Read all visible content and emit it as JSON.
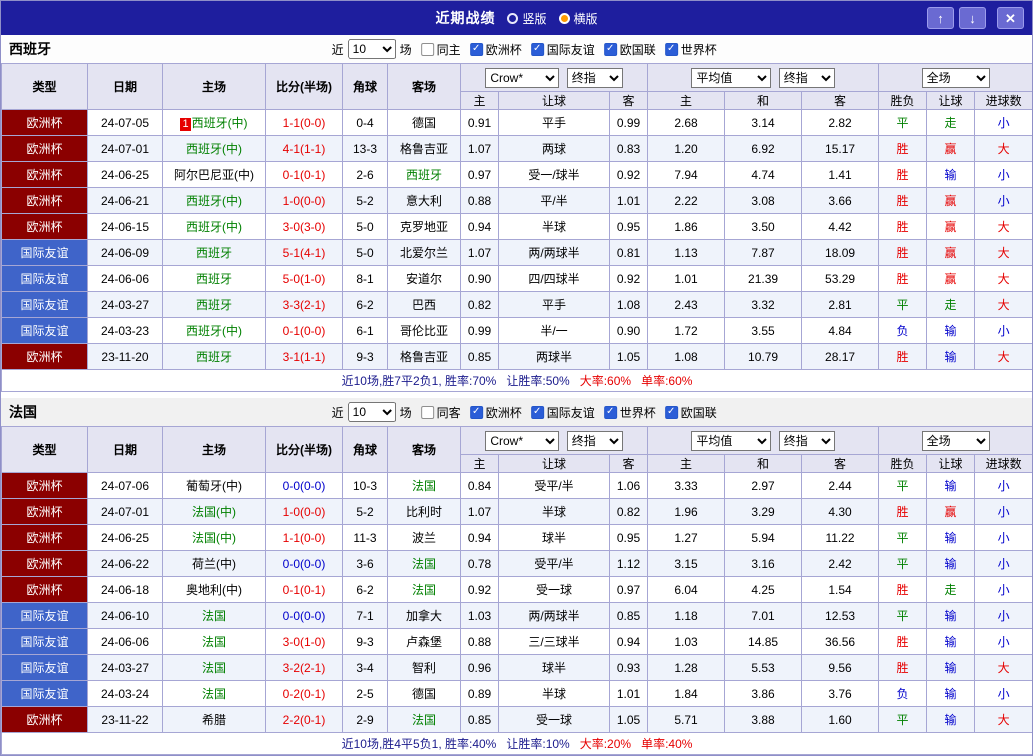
{
  "icons": {
    "check": "✓",
    "up": "↑",
    "down": "↓",
    "close": "✕"
  },
  "palette": {
    "navy": "#1e1e9e",
    "euro": "#8b0000",
    "friendly": "#3f64c9",
    "green": "#008000",
    "red": "#e60000",
    "blue": "#0000cc",
    "orange": "#ff9c00",
    "summary_navy": "#1a1a8c"
  },
  "titlebar": {
    "title": "近期战绩",
    "radios": [
      {
        "label": "竖版",
        "selected": false
      },
      {
        "label": "横版",
        "selected": true
      }
    ]
  },
  "table_header": {
    "type": "类型",
    "date": "日期",
    "home": "主场",
    "score": "比分(半场)",
    "corner": "角球",
    "away": "客场",
    "ah_select_1": "Crow*",
    "ah_select_2": "终指",
    "eu_select_1": "平均值",
    "eu_select_2": "终指",
    "res_select": "全场",
    "sub_ah_home": "主",
    "sub_ah_line": "让球",
    "sub_ah_away": "客",
    "sub_eu_home": "主",
    "sub_eu_draw": "和",
    "sub_eu_away": "客",
    "sub_result": "胜负",
    "sub_ah_result": "让球",
    "sub_ou_result": "进球数"
  },
  "result_colors": {
    "胜": "red",
    "平": "green",
    "负": "blue",
    "赢": "red",
    "走": "green",
    "输": "blue",
    "大": "red",
    "小": "blue"
  },
  "sections": [
    {
      "team": "西班牙",
      "filter": {
        "near": "近",
        "count": "10",
        "games": "场",
        "same": "同主",
        "same_checked": false,
        "comps": [
          {
            "label": "欧洲杯",
            "checked": true
          },
          {
            "label": "国际友谊",
            "checked": true
          },
          {
            "label": "欧国联",
            "checked": true
          },
          {
            "label": "世界杯",
            "checked": true
          }
        ]
      },
      "rows": [
        {
          "type": "欧洲杯",
          "tkey": "euro",
          "date": "24-07-05",
          "home": "西班牙(中)",
          "badge": "1",
          "score": "1-1(0-0)",
          "sc": "red",
          "corner": "0-4",
          "away": "德国",
          "ah": [
            "0.91",
            "平手",
            "0.99"
          ],
          "eu": [
            "2.68",
            "3.14",
            "2.82"
          ],
          "res": [
            "平",
            "走",
            "小"
          ]
        },
        {
          "type": "欧洲杯",
          "tkey": "euro",
          "date": "24-07-01",
          "home": "西班牙(中)",
          "score": "4-1(1-1)",
          "sc": "red",
          "corner": "13-3",
          "away": "格鲁吉亚",
          "ah": [
            "1.07",
            "两球",
            "0.83"
          ],
          "eu": [
            "1.20",
            "6.92",
            "15.17"
          ],
          "res": [
            "胜",
            "赢",
            "大"
          ]
        },
        {
          "type": "欧洲杯",
          "tkey": "euro",
          "date": "24-06-25",
          "home": "阿尔巴尼亚(中)",
          "score": "0-1(0-1)",
          "sc": "red",
          "corner": "2-6",
          "away": "西班牙",
          "ah": [
            "0.97",
            "受一/球半",
            "0.92"
          ],
          "eu": [
            "7.94",
            "4.74",
            "1.41"
          ],
          "res": [
            "胜",
            "输",
            "小"
          ]
        },
        {
          "type": "欧洲杯",
          "tkey": "euro",
          "date": "24-06-21",
          "home": "西班牙(中)",
          "score": "1-0(0-0)",
          "sc": "red",
          "corner": "5-2",
          "away": "意大利",
          "ah": [
            "0.88",
            "平/半",
            "1.01"
          ],
          "eu": [
            "2.22",
            "3.08",
            "3.66"
          ],
          "res": [
            "胜",
            "赢",
            "小"
          ]
        },
        {
          "type": "欧洲杯",
          "tkey": "euro",
          "date": "24-06-15",
          "home": "西班牙(中)",
          "score": "3-0(3-0)",
          "sc": "red",
          "corner": "5-0",
          "away": "克罗地亚",
          "ah": [
            "0.94",
            "半球",
            "0.95"
          ],
          "eu": [
            "1.86",
            "3.50",
            "4.42"
          ],
          "res": [
            "胜",
            "赢",
            "大"
          ]
        },
        {
          "type": "国际友谊",
          "tkey": "friendly",
          "date": "24-06-09",
          "home": "西班牙",
          "score": "5-1(4-1)",
          "sc": "red",
          "corner": "5-0",
          "away": "北爱尔兰",
          "ah": [
            "1.07",
            "两/两球半",
            "0.81"
          ],
          "eu": [
            "1.13",
            "7.87",
            "18.09"
          ],
          "res": [
            "胜",
            "赢",
            "大"
          ]
        },
        {
          "type": "国际友谊",
          "tkey": "friendly",
          "date": "24-06-06",
          "home": "西班牙",
          "score": "5-0(1-0)",
          "sc": "red",
          "corner": "8-1",
          "away": "安道尔",
          "ah": [
            "0.90",
            "四/四球半",
            "0.92"
          ],
          "eu": [
            "1.01",
            "21.39",
            "53.29"
          ],
          "res": [
            "胜",
            "赢",
            "大"
          ]
        },
        {
          "type": "国际友谊",
          "tkey": "friendly",
          "date": "24-03-27",
          "home": "西班牙",
          "score": "3-3(2-1)",
          "sc": "red",
          "corner": "6-2",
          "away": "巴西",
          "ah": [
            "0.82",
            "平手",
            "1.08"
          ],
          "eu": [
            "2.43",
            "3.32",
            "2.81"
          ],
          "res": [
            "平",
            "走",
            "大"
          ]
        },
        {
          "type": "国际友谊",
          "tkey": "friendly",
          "date": "24-03-23",
          "home": "西班牙(中)",
          "score": "0-1(0-0)",
          "sc": "red",
          "corner": "6-1",
          "away": "哥伦比亚",
          "ah": [
            "0.99",
            "半/一",
            "0.90"
          ],
          "eu": [
            "1.72",
            "3.55",
            "4.84"
          ],
          "res": [
            "负",
            "输",
            "小"
          ]
        },
        {
          "type": "欧洲杯",
          "tkey": "euro",
          "date": "23-11-20",
          "home": "西班牙",
          "score": "3-1(1-1)",
          "sc": "red",
          "corner": "9-3",
          "away": "格鲁吉亚",
          "ah": [
            "0.85",
            "两球半",
            "1.05"
          ],
          "eu": [
            "1.08",
            "10.79",
            "28.17"
          ],
          "res": [
            "胜",
            "输",
            "大"
          ]
        }
      ],
      "summary": [
        {
          "text": "近10场,胜7平2负1, 胜率:70%",
          "color": "summary_navy"
        },
        {
          "text": "让胜率:50%",
          "color": "summary_navy"
        },
        {
          "text": "大率:60%",
          "color": "red"
        },
        {
          "text": "单率:60%",
          "color": "red"
        }
      ]
    },
    {
      "team": "法国",
      "filter": {
        "near": "近",
        "count": "10",
        "games": "场",
        "same": "同客",
        "same_checked": false,
        "comps": [
          {
            "label": "欧洲杯",
            "checked": true
          },
          {
            "label": "国际友谊",
            "checked": true
          },
          {
            "label": "世界杯",
            "checked": true
          },
          {
            "label": "欧国联",
            "checked": true
          }
        ]
      },
      "rows": [
        {
          "type": "欧洲杯",
          "tkey": "euro",
          "date": "24-07-06",
          "home": "葡萄牙(中)",
          "score": "0-0(0-0)",
          "sc": "blue",
          "corner": "10-3",
          "away": "法国",
          "ah": [
            "0.84",
            "受平/半",
            "1.06"
          ],
          "eu": [
            "3.33",
            "2.97",
            "2.44"
          ],
          "res": [
            "平",
            "输",
            "小"
          ]
        },
        {
          "type": "欧洲杯",
          "tkey": "euro",
          "date": "24-07-01",
          "home": "法国(中)",
          "score": "1-0(0-0)",
          "sc": "red",
          "corner": "5-2",
          "away": "比利时",
          "ah": [
            "1.07",
            "半球",
            "0.82"
          ],
          "eu": [
            "1.96",
            "3.29",
            "4.30"
          ],
          "res": [
            "胜",
            "赢",
            "小"
          ]
        },
        {
          "type": "欧洲杯",
          "tkey": "euro",
          "date": "24-06-25",
          "home": "法国(中)",
          "score": "1-1(0-0)",
          "sc": "red",
          "corner": "11-3",
          "away": "波兰",
          "ah": [
            "0.94",
            "球半",
            "0.95"
          ],
          "eu": [
            "1.27",
            "5.94",
            "11.22"
          ],
          "res": [
            "平",
            "输",
            "小"
          ]
        },
        {
          "type": "欧洲杯",
          "tkey": "euro",
          "date": "24-06-22",
          "home": "荷兰(中)",
          "score": "0-0(0-0)",
          "sc": "blue",
          "corner": "3-6",
          "away": "法国",
          "ah": [
            "0.78",
            "受平/半",
            "1.12"
          ],
          "eu": [
            "3.15",
            "3.16",
            "2.42"
          ],
          "res": [
            "平",
            "输",
            "小"
          ]
        },
        {
          "type": "欧洲杯",
          "tkey": "euro",
          "date": "24-06-18",
          "home": "奥地利(中)",
          "score": "0-1(0-1)",
          "sc": "red",
          "corner": "6-2",
          "away": "法国",
          "ah": [
            "0.92",
            "受一球",
            "0.97"
          ],
          "eu": [
            "6.04",
            "4.25",
            "1.54"
          ],
          "res": [
            "胜",
            "走",
            "小"
          ]
        },
        {
          "type": "国际友谊",
          "tkey": "friendly",
          "date": "24-06-10",
          "home": "法国",
          "score": "0-0(0-0)",
          "sc": "blue",
          "corner": "7-1",
          "away": "加拿大",
          "ah": [
            "1.03",
            "两/两球半",
            "0.85"
          ],
          "eu": [
            "1.18",
            "7.01",
            "12.53"
          ],
          "res": [
            "平",
            "输",
            "小"
          ]
        },
        {
          "type": "国际友谊",
          "tkey": "friendly",
          "date": "24-06-06",
          "home": "法国",
          "score": "3-0(1-0)",
          "sc": "red",
          "corner": "9-3",
          "away": "卢森堡",
          "ah": [
            "0.88",
            "三/三球半",
            "0.94"
          ],
          "eu": [
            "1.03",
            "14.85",
            "36.56"
          ],
          "res": [
            "胜",
            "输",
            "小"
          ]
        },
        {
          "type": "国际友谊",
          "tkey": "friendly",
          "date": "24-03-27",
          "home": "法国",
          "score": "3-2(2-1)",
          "sc": "red",
          "corner": "3-4",
          "away": "智利",
          "ah": [
            "0.96",
            "球半",
            "0.93"
          ],
          "eu": [
            "1.28",
            "5.53",
            "9.56"
          ],
          "res": [
            "胜",
            "输",
            "大"
          ]
        },
        {
          "type": "国际友谊",
          "tkey": "friendly",
          "date": "24-03-24",
          "home": "法国",
          "score": "0-2(0-1)",
          "sc": "red",
          "corner": "2-5",
          "away": "德国",
          "ah": [
            "0.89",
            "半球",
            "1.01"
          ],
          "eu": [
            "1.84",
            "3.86",
            "3.76"
          ],
          "res": [
            "负",
            "输",
            "小"
          ]
        },
        {
          "type": "欧洲杯",
          "tkey": "euro",
          "date": "23-11-22",
          "home": "希腊",
          "score": "2-2(0-1)",
          "sc": "red",
          "corner": "2-9",
          "away": "法国",
          "ah": [
            "0.85",
            "受一球",
            "1.05"
          ],
          "eu": [
            "5.71",
            "3.88",
            "1.60"
          ],
          "res": [
            "平",
            "输",
            "大"
          ]
        }
      ],
      "summary": [
        {
          "text": "近10场,胜4平5负1, 胜率:40%",
          "color": "summary_navy"
        },
        {
          "text": "让胜率:10%",
          "color": "summary_navy"
        },
        {
          "text": "大率:20%",
          "color": "red"
        },
        {
          "text": "单率:40%",
          "color": "red"
        }
      ]
    }
  ]
}
